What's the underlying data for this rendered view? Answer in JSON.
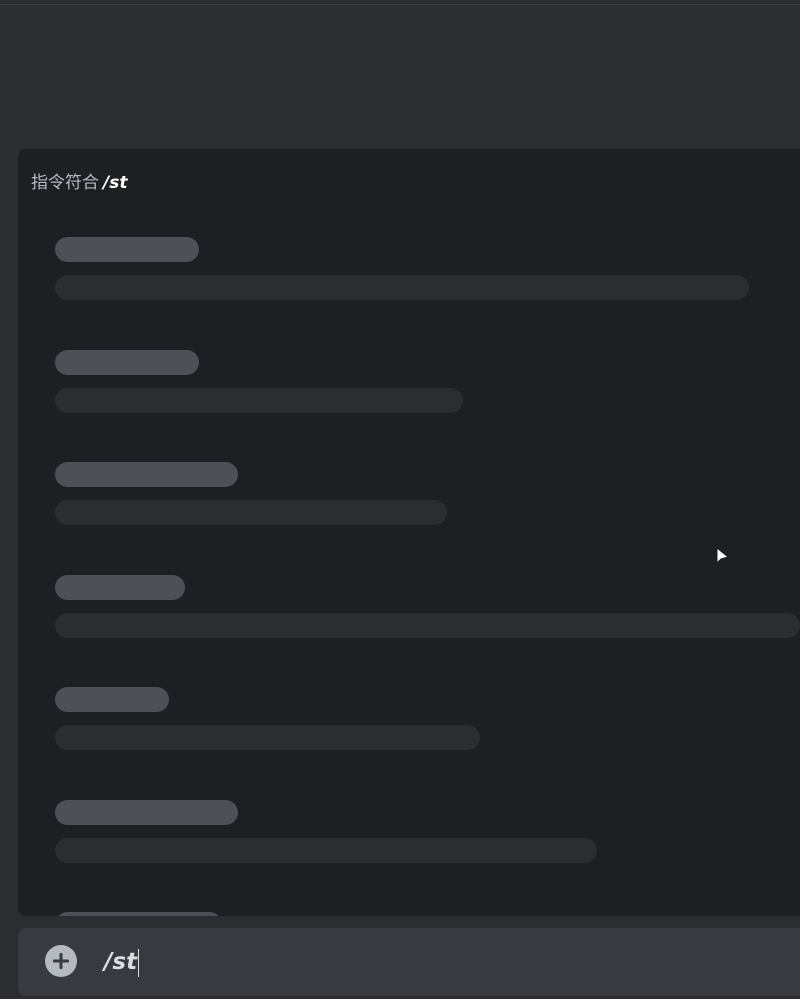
{
  "autocomplete": {
    "header_prefix": "指令符合",
    "header_query": "/st",
    "placeholders": [
      {
        "title_width": 144,
        "desc_width": 694
      },
      {
        "title_width": 144,
        "desc_width": 408
      },
      {
        "title_width": 183,
        "desc_width": 392
      },
      {
        "title_width": 130,
        "desc_width": 745
      },
      {
        "title_width": 114,
        "desc_width": 425
      },
      {
        "title_width": 183,
        "desc_width": 542
      },
      {
        "title_width": 167,
        "desc_width": 0
      }
    ]
  },
  "composer": {
    "add_icon": "plus-circle-icon",
    "input_value": "/st"
  },
  "colors": {
    "background": "#2b2d31",
    "popup_background": "#1e1f22",
    "skeleton_title": "#4e5058",
    "skeleton_desc": "#2b2d31",
    "composer_background": "#383a40"
  }
}
